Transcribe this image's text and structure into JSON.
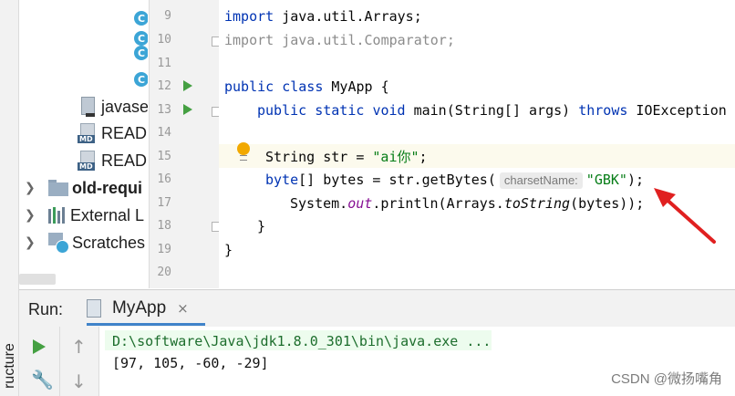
{
  "side": {
    "structure_label": "ructure"
  },
  "project_tree": {
    "items": [
      {
        "icon": "class-icon",
        "label": ""
      },
      {
        "icon": "class-icon",
        "label": ""
      },
      {
        "icon": "class-icon",
        "label": ""
      },
      {
        "icon": "class-icon",
        "label": ""
      },
      {
        "icon": "java-file-icon",
        "label": "javase"
      },
      {
        "icon": "markdown-icon",
        "label": "READ"
      },
      {
        "icon": "markdown-icon",
        "label": "READ"
      },
      {
        "icon": "folder-icon",
        "label": "old-requi"
      },
      {
        "icon": "library-icon",
        "label": "External L"
      },
      {
        "icon": "scratches-icon",
        "label": "Scratches"
      }
    ],
    "md_tag": "MD",
    "class_glyph": "C"
  },
  "gutter": {
    "line_numbers": [
      "9",
      "10",
      "11",
      "12",
      "13",
      "14",
      "15",
      "16",
      "17",
      "18",
      "19",
      "20"
    ]
  },
  "editor": {
    "line9": {
      "kw": "import",
      "rest": " java.util.Arrays;"
    },
    "line10": {
      "kw": "import",
      "rest": " java.util.Comparator;"
    },
    "line12": {
      "kw1": "public",
      "kw2": "class",
      "rest": " MyApp {"
    },
    "line13": {
      "kw1": "public",
      "kw2": "static",
      "kw3": "void",
      "mid": " main(String[] args) ",
      "kw4": "throws",
      "rest": " IOException {"
    },
    "line15": {
      "pre": "String str = ",
      "str": "\"ai你\"",
      "post": ";"
    },
    "line16": {
      "kw": "byte",
      "pre": "[] bytes = str.getBytes(",
      "hint": "charsetName:",
      "str": "\"GBK\"",
      "post": ");"
    },
    "line17": {
      "pre": "System.",
      "field": "out",
      "mid": ".println(Arrays.",
      "method": "toString",
      "post": "(bytes));"
    },
    "line18": {
      "text": "}"
    },
    "line19": {
      "text": "}"
    }
  },
  "run_panel": {
    "label": "Run:",
    "tab_name": "MyApp",
    "close_glyph": "×",
    "console": {
      "command": "D:\\software\\Java\\jdk1.8.0_301\\bin\\java.exe ...",
      "output": "[97, 105, -60, -29]"
    }
  },
  "watermark": "CSDN @微扬嘴角",
  "colors": {
    "annotation_arrow": "#e02020",
    "run_green": "#45a042",
    "keyword": "#0033b3",
    "string": "#067d17"
  }
}
